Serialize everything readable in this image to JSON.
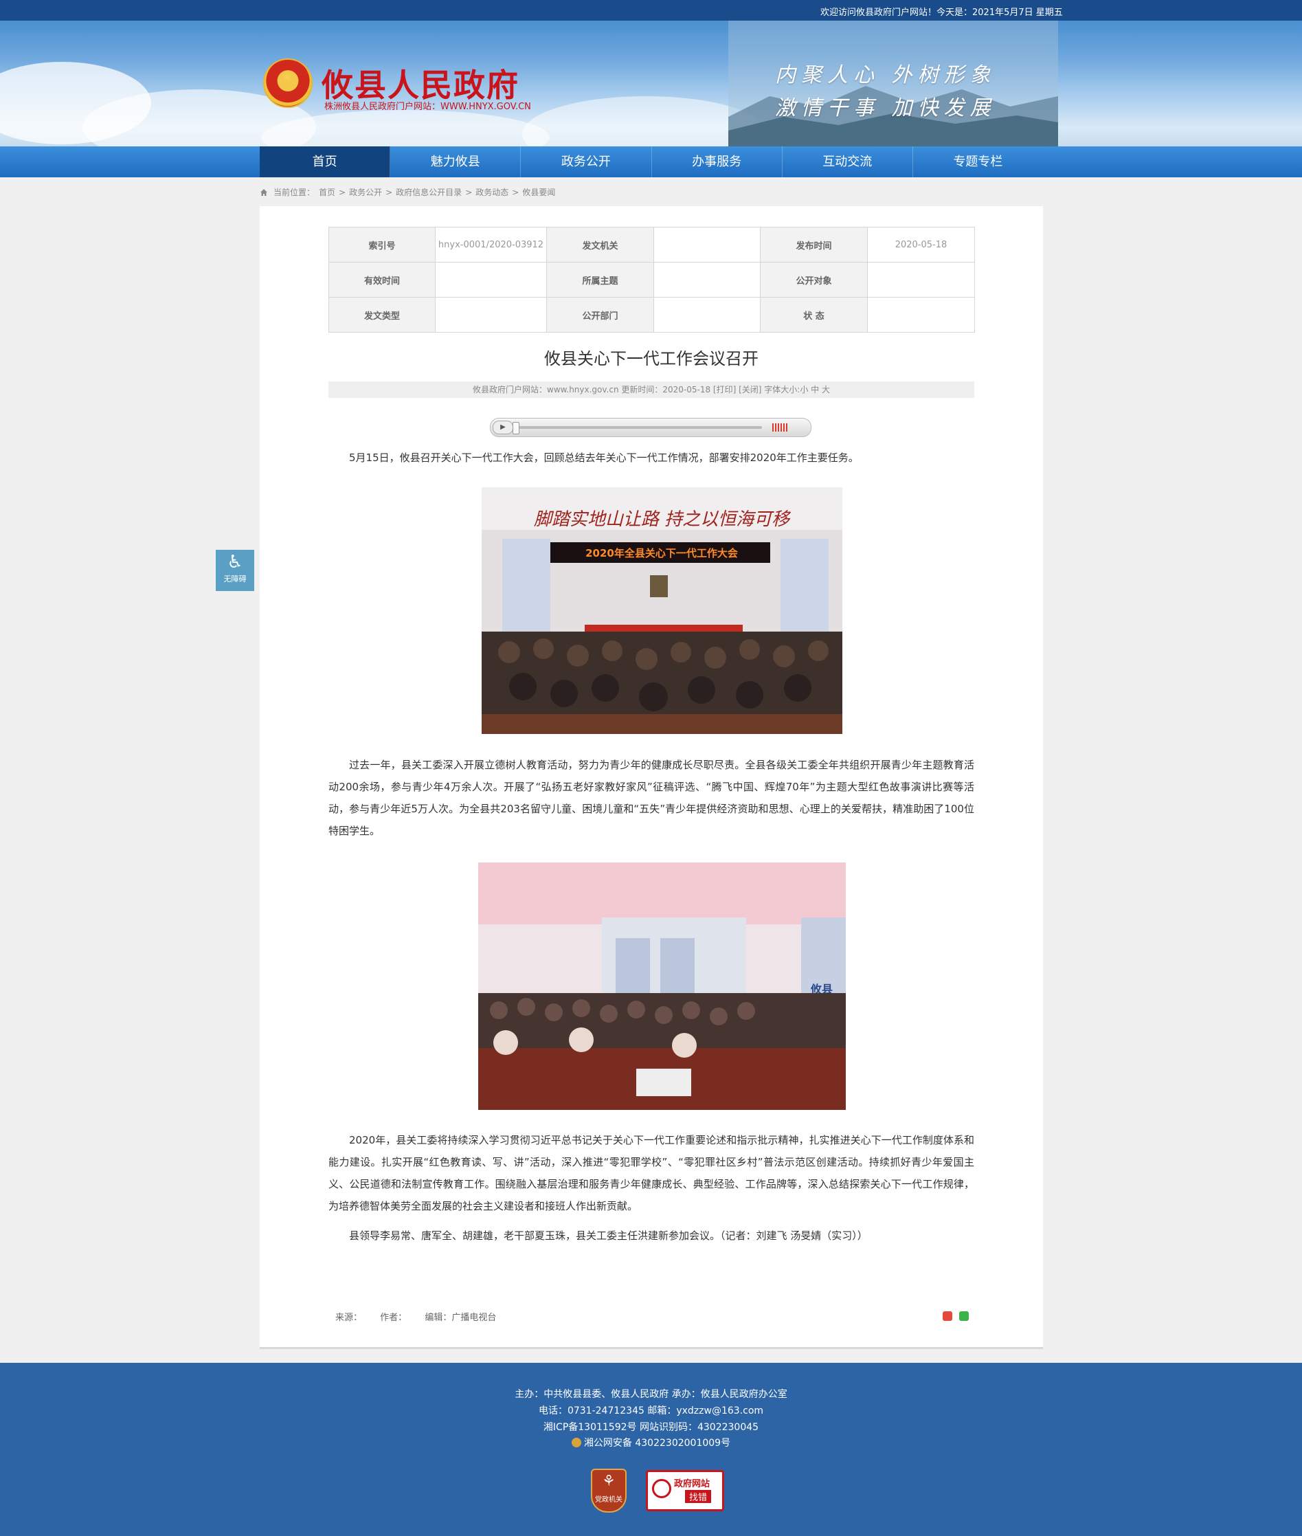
{
  "topbar": {
    "welcome": "欢迎访问攸县政府门户网站！今天是：2021年5月7日 星期五"
  },
  "header": {
    "site_name": "攸县人民政府",
    "site_sub": "株洲攸县人民政府门户网站：WWW.HNYX.GOV.CN",
    "slogan_1": "内聚人心  外树形象",
    "slogan_2": "激情干事  加快发展"
  },
  "nav": {
    "items": [
      {
        "label": "首页",
        "active": true
      },
      {
        "label": "魅力攸县"
      },
      {
        "label": "政务公开"
      },
      {
        "label": "办事服务"
      },
      {
        "label": "互动交流"
      },
      {
        "label": "专题专栏"
      }
    ]
  },
  "breadcrumb": {
    "prefix": "当前位置：",
    "items": [
      "首页",
      "政务公开",
      "政府信息公开目录",
      "政务动态",
      "攸县要闻"
    ]
  },
  "meta": {
    "index_label": "索引号",
    "index_value": "hnyx-0001/2020-03912",
    "issuer_label": "发文机关",
    "issuer_value": "",
    "date_label": "发布时间",
    "date_value": "2020-05-18",
    "valid_label": "有效时间",
    "valid_value": "",
    "topic_label": "所属主题",
    "topic_value": "",
    "audience_label": "公开对象",
    "audience_value": "",
    "type_label": "发文类型",
    "type_value": "",
    "dept_label": "公开部门",
    "dept_value": "",
    "status_label": "状 态",
    "status_value": ""
  },
  "article": {
    "title": "攸县关心下一代工作会议召开",
    "info": "攸县政府门户网站：www.hnyx.gov.cn   更新时间：2020-05-18   [打印] [关闭]   字体大小:小 中 大",
    "p1": "5月15日，攸县召开关心下一代工作大会，回顾总结去年关心下一代工作情况，部署安排2020年工作主要任务。",
    "photo1_banner": "脚踏实地山让路  持之以恒海可移",
    "photo1_screen": "2020年全县关心下一代工作大会",
    "p2": "过去一年，县关工委深入开展立德树人教育活动，努力为青少年的健康成长尽职尽责。全县各级关工委全年共组织开展青少年主题教育活动200余场，参与青少年4万余人次。开展了“弘扬五老好家教好家风”征稿评选、“腾飞中国、辉煌70年”为主题大型红色故事演讲比赛等活动，参与青少年近5万人次。为全县共203名留守儿童、困境儿童和“五失”青少年提供经济资助和思想、心理上的关爱帮扶，精准助困了100位特困学生。",
    "photo2_sign": "攸县",
    "p3": "2020年，县关工委将持续深入学习贯彻习近平总书记关于关心下一代工作重要论述和指示批示精神，扎实推进关心下一代工作制度体系和能力建设。扎实开展“红色教育读、写、讲”活动，深入推进“零犯罪学校”、“零犯罪社区乡村”普法示范区创建活动。持续抓好青少年爱国主义、公民道德和法制宣传教育工作。围绕融入基层治理和服务青少年健康成长、典型经验、工作品牌等，深入总结探索关心下一代工作规律，为培养德智体美劳全面发展的社会主义建设者和接班人作出新贡献。",
    "p4": "县领导李易常、唐军全、胡建雄，老干部夏玉珠，县关工委主任洪建新参加会议。（记者：刘建飞 汤旻婧（实习））",
    "source": "来源：",
    "author": "作者：",
    "editor": "编辑：广播电视台"
  },
  "accessibility": {
    "label": "无障碍"
  },
  "footer": {
    "sponsor": "主办：中共攸县县委、攸县人民政府  承办：攸县人民政府办公室",
    "contact": "电话：0731-24712345  邮箱：yxdzzw@163.com",
    "icp": "湘ICP备13011592号   网站识别码：4302230045",
    "police": "湘公网安备 43022302001009号",
    "badge1_text": "党政机关",
    "badge2_line1": "政府网站",
    "badge2_line2": "找错"
  }
}
